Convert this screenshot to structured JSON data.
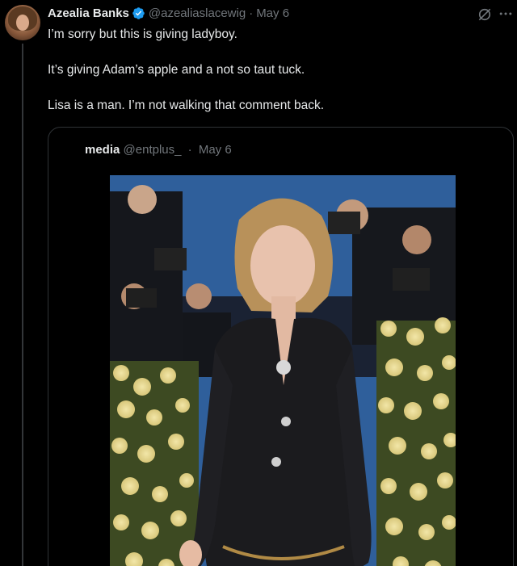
{
  "tweet": {
    "author_name": "Azealia Banks",
    "author_handle": "@azealiaslacewig",
    "separator": "·",
    "date": "May 6",
    "text_lines": [
      "I’m sorry but this is giving ladyboy.",
      "It’s giving Adam’s apple and a not so taut tuck.",
      "Lisa is a man. I’m not walking that comment back."
    ]
  },
  "quote": {
    "author_name": "media",
    "author_handle": "@entplus_",
    "separator": "·",
    "date": "May 6"
  },
  "icons": {
    "verified": "verified-badge-icon",
    "grok": "grok-icon",
    "more": "more-options-icon"
  },
  "colors": {
    "background": "#000000",
    "text": "#e7e9ea",
    "muted": "#71767b",
    "verified": "#1d9bf0",
    "border": "#2f3336"
  }
}
